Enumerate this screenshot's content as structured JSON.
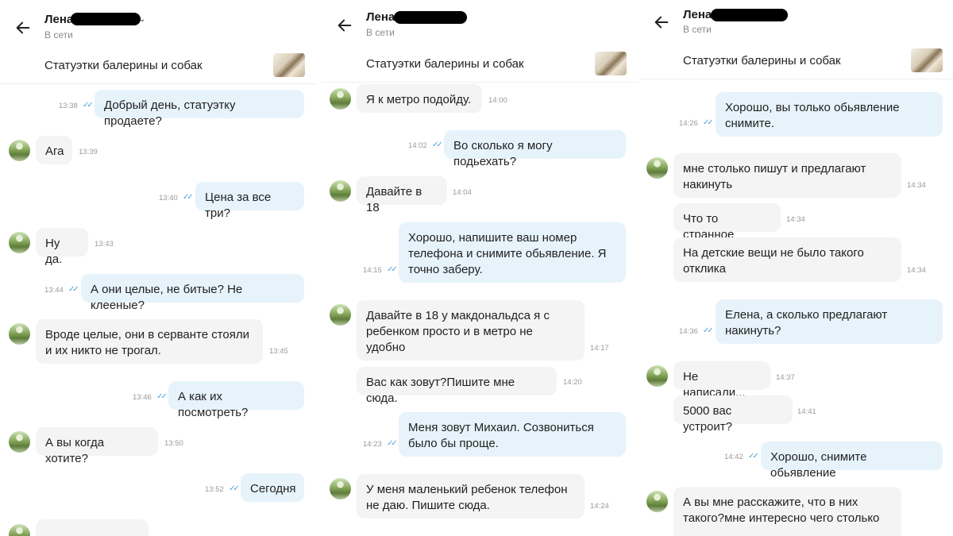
{
  "contact": {
    "name": "Лена",
    "status": "В сети"
  },
  "item": {
    "title": "Статуэтки балерины и собак"
  },
  "panels": [
    {
      "messages": [
        {
          "text": "Добрый день, статуэтку продаете?",
          "time": "13:38",
          "dir": "out"
        },
        {
          "text": "Ага",
          "time": "13:39",
          "dir": "in"
        },
        {
          "text": "Цена за все три?",
          "time": "13:40",
          "dir": "out"
        },
        {
          "text": "Ну да.",
          "time": "13:43",
          "dir": "in"
        },
        {
          "text": "А они целые, не битые? Не клееные?",
          "time": "13:44",
          "dir": "out"
        },
        {
          "text": "Вроде целые, они в серванте стояли и их никто не трогал.",
          "time": "13:45",
          "dir": "in"
        },
        {
          "text": "А как их посмотреть?",
          "time": "13:46",
          "dir": "out"
        },
        {
          "text": "А вы когда хотите?",
          "time": "13:50",
          "dir": "in"
        },
        {
          "text": "Сегодня",
          "time": "13:52",
          "dir": "out"
        }
      ]
    },
    {
      "messages": [
        {
          "text": "Я к метро подойду.",
          "time": "14:00",
          "dir": "in"
        },
        {
          "text": "Во сколько я могу подьехать?",
          "time": "14:02",
          "dir": "out"
        },
        {
          "text": "Давайте в 18",
          "time": "14:04",
          "dir": "in"
        },
        {
          "text": "Хорошо, напишите ваш номер телефона и снимите обьявление. Я точно заберу.",
          "time": "14:15",
          "dir": "out"
        },
        {
          "text": "Давайте в 18 у макдональдса я с ребенком просто и в метро не удобно",
          "time": "14:17",
          "dir": "in"
        },
        {
          "text": "Вас как зовут?Пишите мне сюда.",
          "time": "14:20",
          "dir": "in"
        },
        {
          "text": "Меня зовут Михаил. Созвониться было бы проще.",
          "time": "14:23",
          "dir": "out"
        },
        {
          "text": "У меня маленький ребенок телефон не даю. Пишите сюда.",
          "time": "14:24",
          "dir": "in"
        }
      ]
    },
    {
      "messages": [
        {
          "text": "Хорошо, вы только обьявление снимите.",
          "time": "14:26",
          "dir": "out"
        },
        {
          "text": "мне столько пишут и предлагают накинуть",
          "time": "14:34",
          "dir": "in"
        },
        {
          "text": "Что то странное",
          "time": "14:34",
          "dir": "in"
        },
        {
          "text": "На детские вещи не было такого отклика",
          "time": "14:34",
          "dir": "in"
        },
        {
          "text": "Елена, а сколько предлагают накинуть?",
          "time": "14:36",
          "dir": "out"
        },
        {
          "text": "Не написали...",
          "time": "14:37",
          "dir": "in"
        },
        {
          "text": "5000 вас устроит?",
          "time": "14:41",
          "dir": "in"
        },
        {
          "text": "Хорошо, снимите обьявление",
          "time": "14:42",
          "dir": "out"
        },
        {
          "text": "А вы мне расскажите, что в них такого?мне интересно чего столько",
          "time": "",
          "dir": "in"
        }
      ]
    }
  ]
}
